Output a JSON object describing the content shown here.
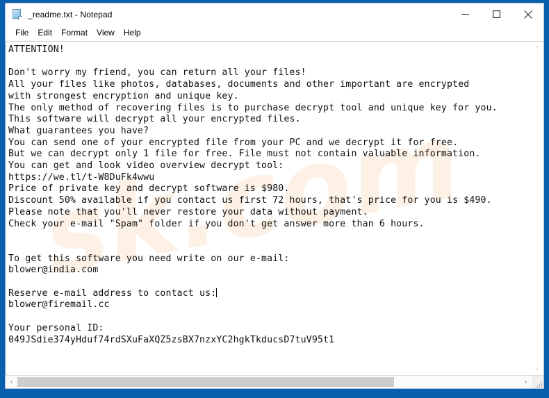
{
  "window": {
    "title": "_readme.txt - Notepad",
    "icon": "notepad-document-icon",
    "controls": {
      "minimize": "Minimize",
      "maximize": "Maximize",
      "close": "Close"
    }
  },
  "menu": {
    "items": [
      {
        "label": "File"
      },
      {
        "label": "Edit"
      },
      {
        "label": "Format"
      },
      {
        "label": "View"
      },
      {
        "label": "Help"
      }
    ]
  },
  "document": {
    "filename": "_readme.txt",
    "heading": "ATTENTION!",
    "body_part_1": "ATTENTION!\n\nDon't worry my friend, you can return all your files!\nAll your files like photos, databases, documents and other important are encrypted\nwith strongest encryption and unique key.\nThe only method of recovering files is to purchase decrypt tool and unique key for you.\nThis software will decrypt all your encrypted files.\nWhat guarantees you have?\nYou can send one of your encrypted file from your PC and we decrypt it for free.\nBut we can decrypt only 1 file for free. File must not contain valuable information.\nYou can get and look video overview decrypt tool:\nhttps://we.tl/t-W8DuFk4wwu\nPrice of private key and decrypt software is $980.\nDiscount 50% available if you contact us first 72 hours, that's price for you is $490.\nPlease note that you'll never restore your data without payment.\nCheck your e-mail \"Spam\" folder if you don't get answer more than 6 hours.\n\n\nTo get this software you need write on our e-mail:\nblower@india.com\n\nReserve e-mail address to contact us:",
    "body_part_2": "\nblower@firemail.cc\n\nYour personal ID:\n049JSdie374yHduf74rdSXuFaXQZ5zsBX7nzxYC2hgkTkducsD7tuV95t1",
    "video_url": "https://we.tl/t-W8DuFk4wwu",
    "price_full": "$980",
    "price_discount": "$490",
    "discount_percent": "50%",
    "discount_window_hours": "72 hours",
    "answer_time_hours": "6 hours",
    "email_primary": "blower@india.com",
    "email_reserve": "blower@firemail.cc",
    "personal_id": "049JSdie374yHduf74rdSXuFaXQZ5zsBX7nzxYC2hgkTkducsD7tuV95t1"
  },
  "watermark": {
    "text": "sk.com"
  },
  "scrollbars": {
    "vertical": {
      "up_arrow": "˄",
      "down_arrow": "˅"
    },
    "horizontal": {
      "left_arrow": "‹",
      "right_arrow": "›",
      "thumb_percent": "75"
    }
  },
  "colors": {
    "desktop_blue": "#0a5fad",
    "window_bg": "#ffffff",
    "text": "#111111",
    "scroll_thumb": "#cdcdcd",
    "watermark": "#fdf1e6"
  }
}
